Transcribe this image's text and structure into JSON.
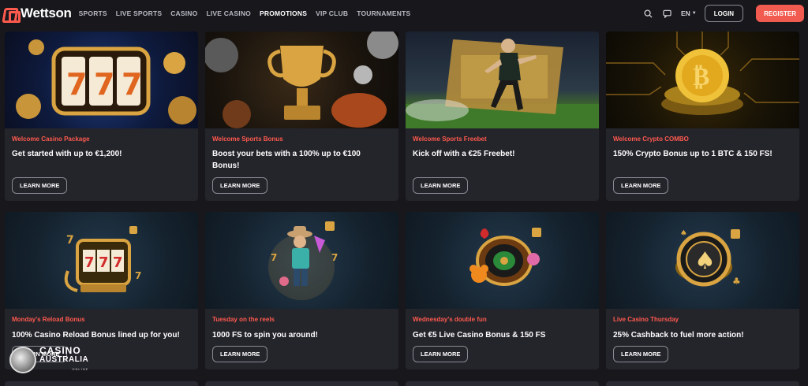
{
  "brand": {
    "name": "Wettson"
  },
  "nav": [
    {
      "label": "SPORTS"
    },
    {
      "label": "LIVE SPORTS"
    },
    {
      "label": "CASINO"
    },
    {
      "label": "LIVE CASINO"
    },
    {
      "label": "PROMOTIONS",
      "active": true
    },
    {
      "label": "VIP CLUB"
    },
    {
      "label": "TOURNAMENTS"
    }
  ],
  "header": {
    "language": "EN",
    "login_label": "LOGIN",
    "register_label": "REGISTER",
    "accent_color": "#f15b50"
  },
  "promotions": [
    {
      "tag": "Welcome Casino Package",
      "title": "Get started with up to €1,200!",
      "cta": "LEARN MORE",
      "art": "slot-777-coins"
    },
    {
      "tag": "Welcome Sports Bonus",
      "title": "Boost your bets with a 100% up to €100 Bonus!",
      "cta": "LEARN MORE",
      "art": "gold-trophy-balls"
    },
    {
      "tag": "Welcome Sports Freebet",
      "title": "Kick off with a €25 Freebet!",
      "cta": "LEARN MORE",
      "art": "footballer-ticket"
    },
    {
      "tag": "Welcome Crypto COMBO",
      "title": "150% Crypto Bonus up to 1 BTC & 150 FS!",
      "cta": "LEARN MORE",
      "art": "bitcoin-coin"
    },
    {
      "tag": "Monday's Reload Bonus",
      "title": "100% Casino Reload Bonus lined up for you!",
      "cta": "LEARN MORE",
      "art": "slot-machine-777"
    },
    {
      "tag": "Tuesday on the reels",
      "title": "1000 FS to spin you around!",
      "cta": "LEARN MORE",
      "art": "cowboy-character"
    },
    {
      "tag": "Wednesday's double fun",
      "title": "Get €5 Live Casino Bonus & 150 FS",
      "cta": "LEARN MORE",
      "art": "roulette-wheel-bear"
    },
    {
      "tag": "Live Casino Thursday",
      "title": "25% Cashback to fuel more action!",
      "cta": "LEARN MORE",
      "art": "poker-chip-spade"
    }
  ],
  "watermark": {
    "line1": "CASINO",
    "line2": "AUSTRALIA",
    "line3": "ONLINE"
  }
}
